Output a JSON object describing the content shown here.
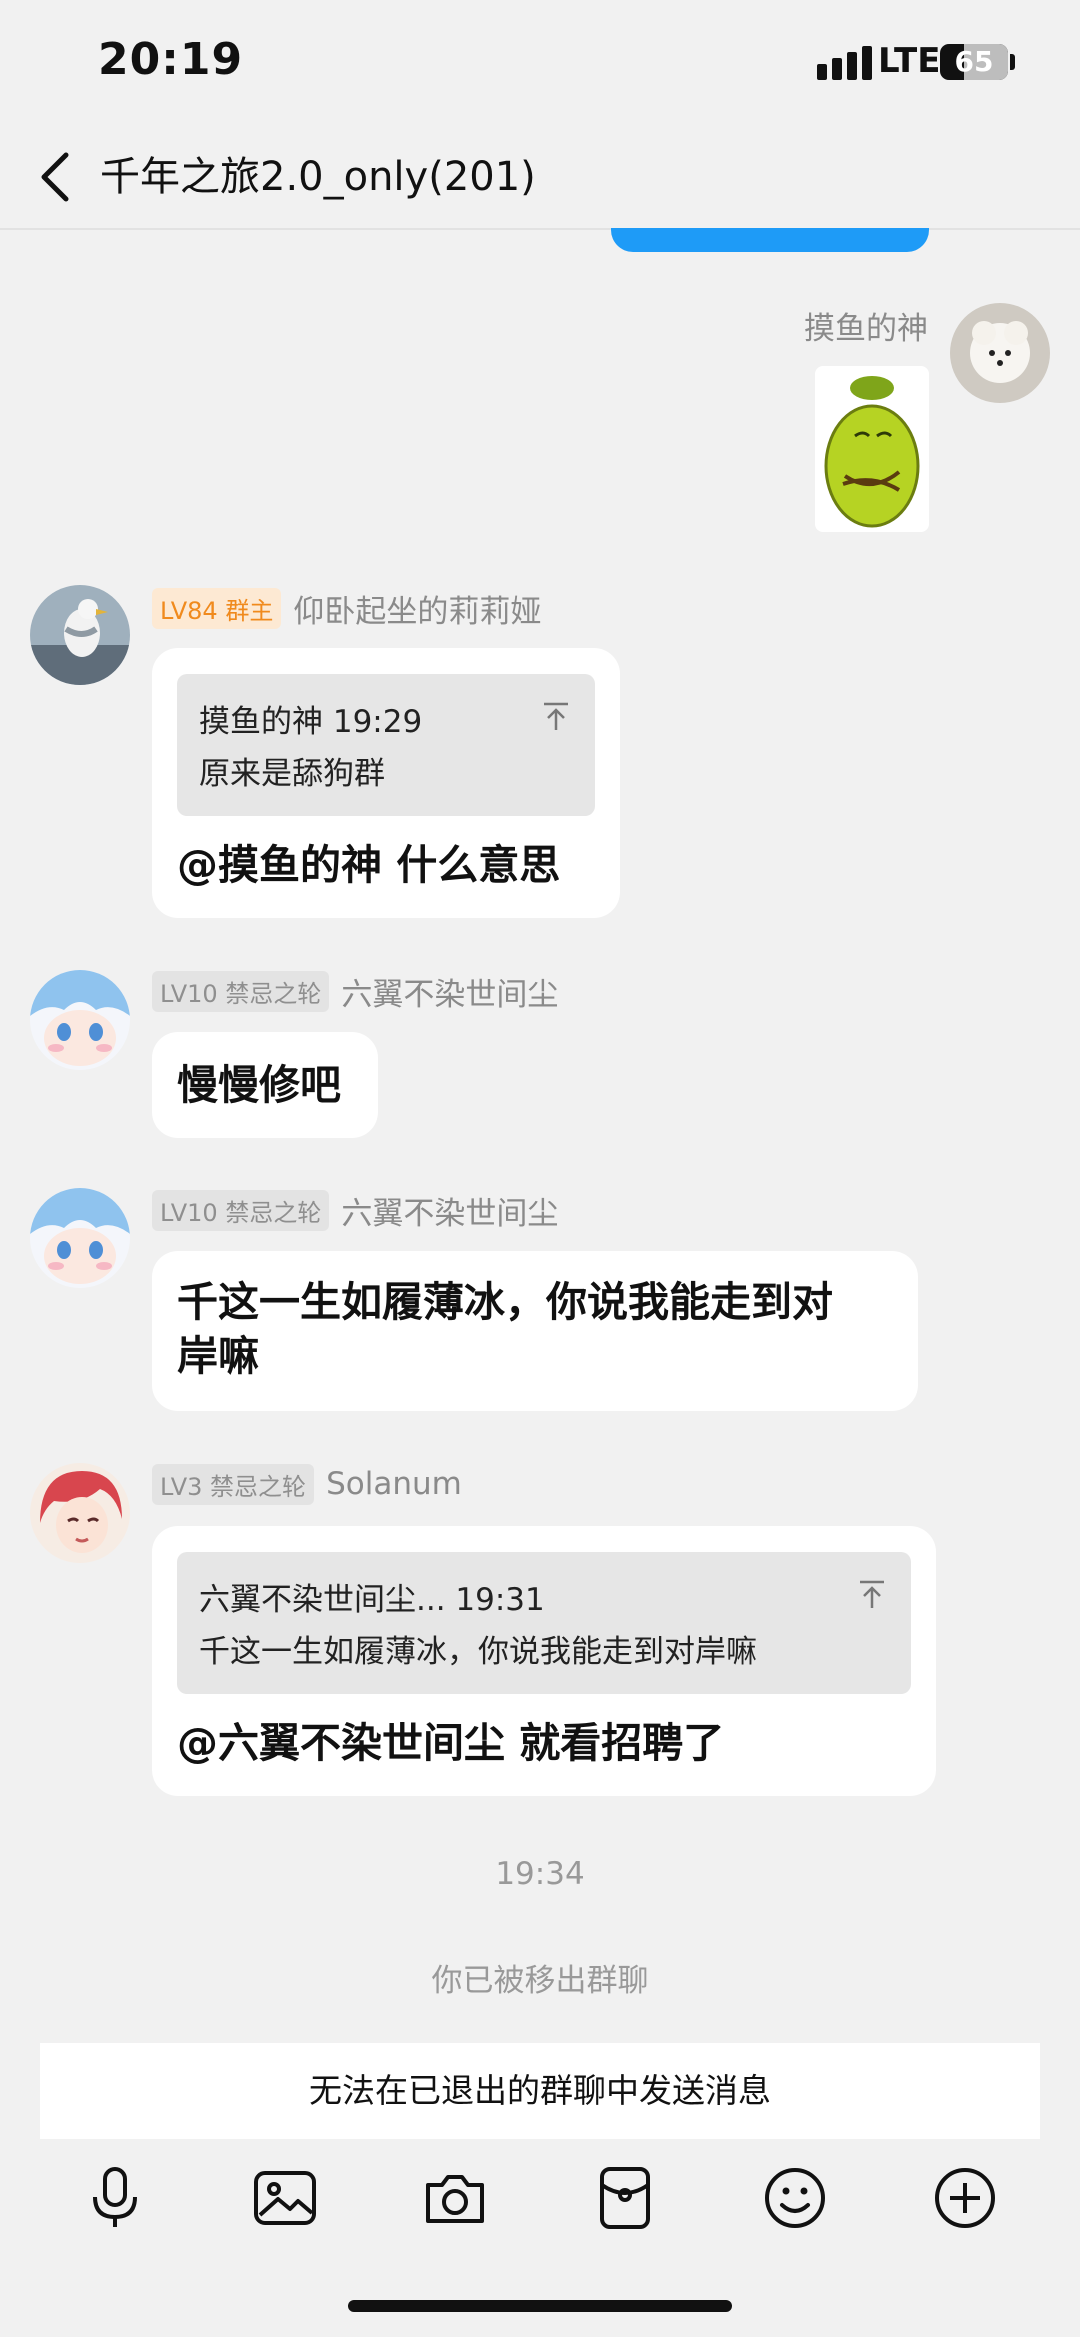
{
  "status_bar": {
    "time": "20:19",
    "network": "LTE",
    "battery": "65",
    "battery_level": 0.65
  },
  "header": {
    "title": "千年之旅2.0_only(201)",
    "back_icon": "chevron-left-icon"
  },
  "messages": [
    {
      "sender": "摸鱼的神",
      "direction": "outgoing",
      "type": "sticker",
      "sticker_icon": "green-bean-meme-sticker"
    },
    {
      "badge": "LV84 群主",
      "sender": "仰卧起坐的莉莉娅",
      "quote": {
        "header": "摸鱼的神 19:29",
        "text": "原来是舔狗群"
      },
      "text": "@摸鱼的神 什么意思"
    },
    {
      "badge": "LV10 禁忌之轮",
      "sender": "六翼不染世间尘",
      "text": "慢慢修吧"
    },
    {
      "badge": "LV10 禁忌之轮",
      "sender": "六翼不染世间尘",
      "text_line1": "千这一生如履薄冰，你说我能走到对",
      "text_line2": "岸嘛"
    },
    {
      "badge": "LV3 禁忌之轮",
      "sender": "Solanum",
      "quote": {
        "header": "六翼不染世间尘... 19:31",
        "text": "千这一生如履薄冰，你说我能走到对岸嘛"
      },
      "text": "@六翼不染世间尘 就看招聘了"
    }
  ],
  "timestamp": "19:34",
  "system_notice": "你已被移出群聊",
  "input_disabled_text": "无法在已退出的群聊中发送消息",
  "toolbar": [
    {
      "icon": "microphone-icon"
    },
    {
      "icon": "image-icon"
    },
    {
      "icon": "camera-icon"
    },
    {
      "icon": "red-packet-icon"
    },
    {
      "icon": "emoji-icon"
    },
    {
      "icon": "plus-icon"
    }
  ],
  "colors": {
    "accent": "#1E9BF7",
    "owner_badge": "#F08A1D",
    "background": "#F1F1F1"
  }
}
